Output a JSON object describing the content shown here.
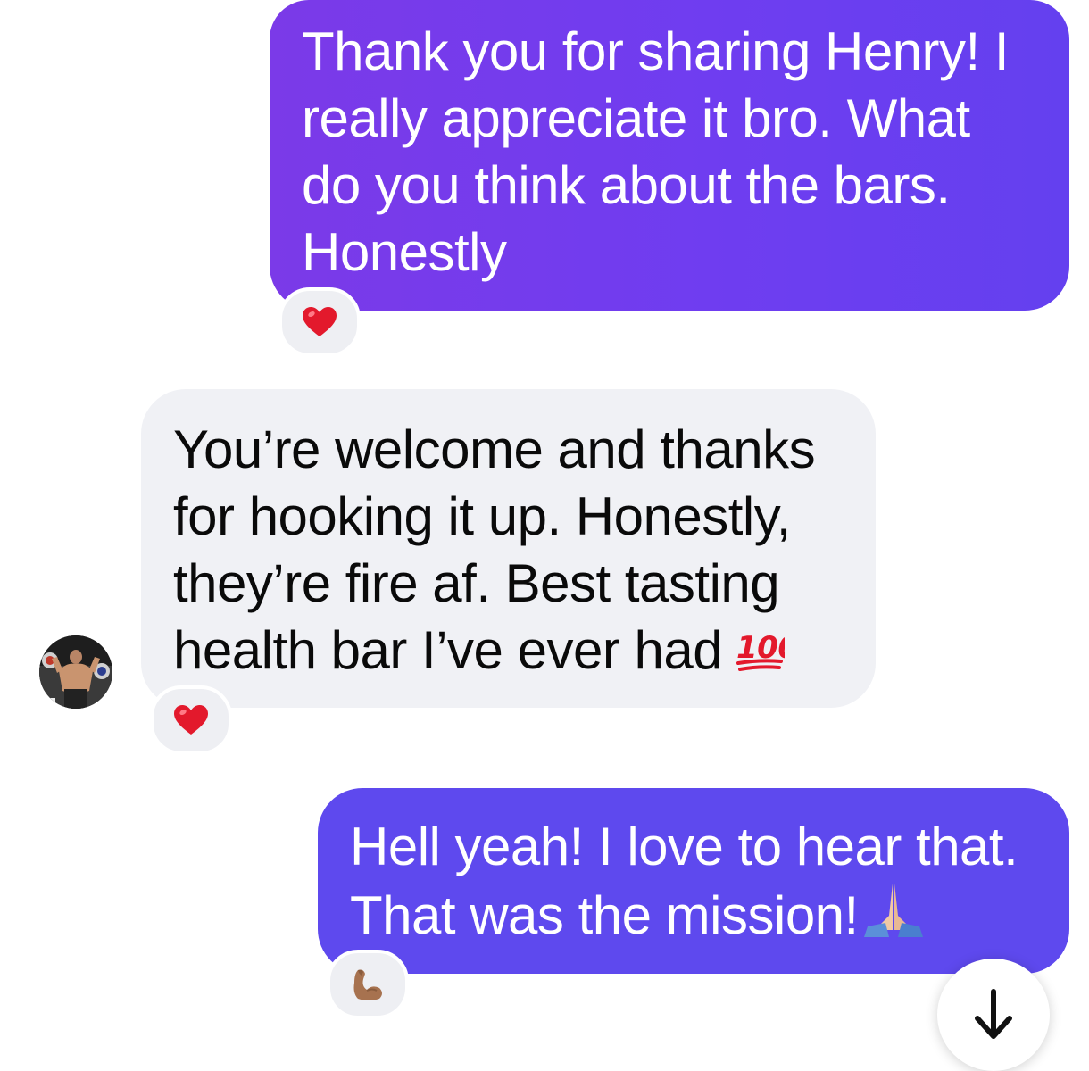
{
  "messages": [
    {
      "direction": "outgoing",
      "lines": [
        "Thank you for sharing Henry! I",
        "really appreciate it bro. What",
        "do you think about the bars.",
        "Honestly"
      ],
      "reaction": "heart-emoji"
    },
    {
      "direction": "incoming",
      "lines": [
        "You’re welcome and thanks",
        "for hooking it up. Honestly,",
        "they’re fire af. Best tasting",
        "health bar I’ve ever had"
      ],
      "inline_emoji": "100-emoji",
      "reaction": "heart-emoji"
    },
    {
      "direction": "outgoing",
      "lines": [
        "Hell yeah! I love to hear that.",
        "That was the mission!"
      ],
      "inline_emoji": "folded-hands-emoji",
      "reaction": "flexed-biceps-emoji"
    }
  ],
  "colors": {
    "outgoing_bubble_1": "#7340ec",
    "outgoing_bubble_2": "#5e49ee",
    "incoming_bubble": "#f0f1f5",
    "reaction_bg": "#eeeff3"
  },
  "scroll_button": {
    "icon": "arrow-down-icon"
  }
}
